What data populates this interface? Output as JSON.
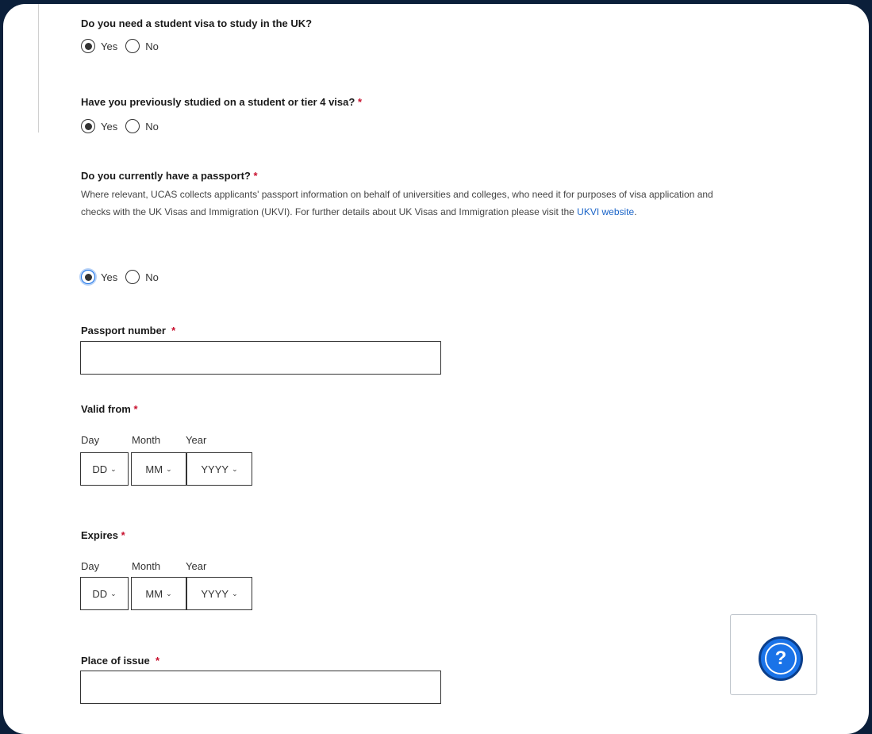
{
  "form": {
    "q_visa": {
      "label": "Do you need a student visa to study in the UK?",
      "yes": "Yes",
      "no": "No",
      "selected": "Yes"
    },
    "q_previous": {
      "label": "Have you previously studied on a student or tier 4 visa?",
      "required": "*",
      "yes": "Yes",
      "no": "No",
      "selected": "Yes"
    },
    "q_passport": {
      "label": "Do you currently have a passport?",
      "required": "*",
      "help_text": "Where relevant, UCAS collects applicants' passport information on behalf of universities and colleges, who need it for purposes of visa application and checks with the UK Visas and Immigration (UKVI). For further details about UK Visas and Immigration please visit the ",
      "help_link": "UKVI website",
      "help_end": ".",
      "yes": "Yes",
      "no": "No",
      "selected": "Yes"
    },
    "passport_number": {
      "label": "Passport number",
      "required": "*",
      "value": ""
    },
    "valid_from": {
      "label": "Valid from",
      "required": "*",
      "day_label": "Day",
      "month_label": "Month",
      "year_label": "Year",
      "day": "DD",
      "month": "MM",
      "year": "YYYY"
    },
    "expires": {
      "label": "Expires",
      "required": "*",
      "day_label": "Day",
      "month_label": "Month",
      "year_label": "Year",
      "day": "DD",
      "month": "MM",
      "year": "YYYY"
    },
    "place_of_issue": {
      "label": "Place of issue",
      "required": "*",
      "value": ""
    }
  },
  "help_widget": {
    "icon": "question-icon",
    "glyph": "?",
    "accent": "#1a73e8"
  },
  "colors": {
    "background": "#0b1f3a",
    "required": "#c8102e",
    "link": "#1a64c8"
  }
}
